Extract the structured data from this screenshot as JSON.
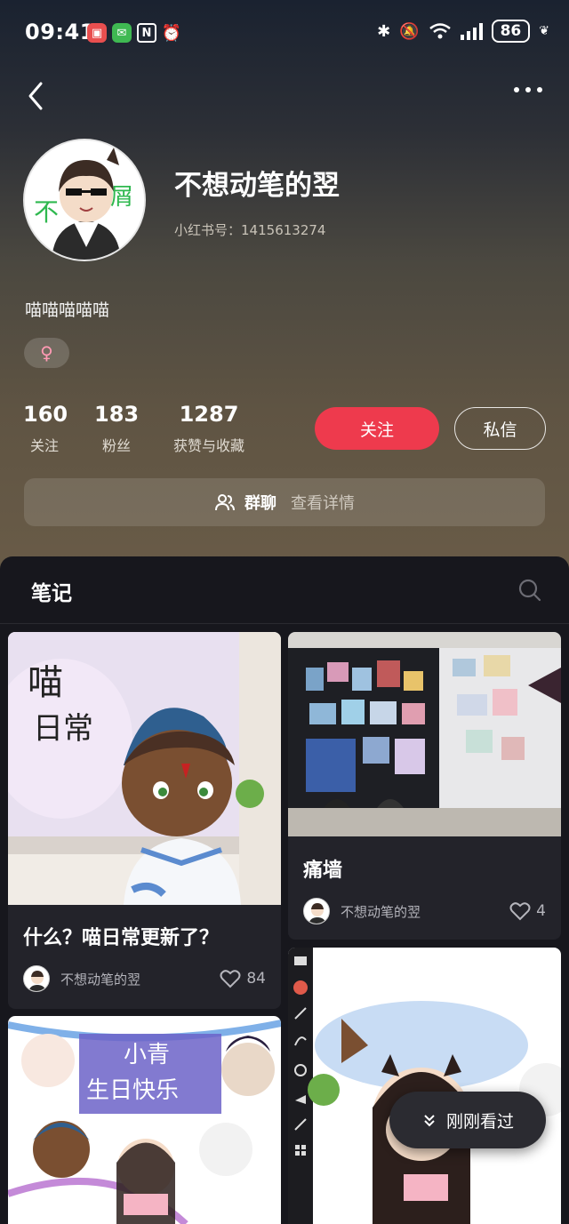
{
  "status_bar": {
    "time": "09:41",
    "battery": "86"
  },
  "profile": {
    "name": "不想动笔的翌",
    "id_label": "小红书号：",
    "id_value": "1415613274",
    "bio": "喵喵喵喵喵",
    "gender_symbol": "♀"
  },
  "stats": [
    {
      "value": "160",
      "label": "关注"
    },
    {
      "value": "183",
      "label": "粉丝"
    },
    {
      "value": "1287",
      "label": "获赞与收藏"
    }
  ],
  "actions": {
    "follow": "关注",
    "message": "私信"
  },
  "group_chat": {
    "label": "群聊",
    "detail": "查看详情"
  },
  "notes": {
    "tab_title": "笔记",
    "cards": [
      {
        "title": "什么？喵日常更新了？",
        "author": "不想动笔的翌",
        "likes": "84"
      },
      {
        "title": "痛墙",
        "author": "不想动笔的翌",
        "likes": "4"
      }
    ]
  },
  "recently_viewed": "刚刚看过",
  "colors": {
    "accent": "#ee3a4d",
    "panel_bg": "#17171d",
    "card_bg": "#23232a"
  }
}
